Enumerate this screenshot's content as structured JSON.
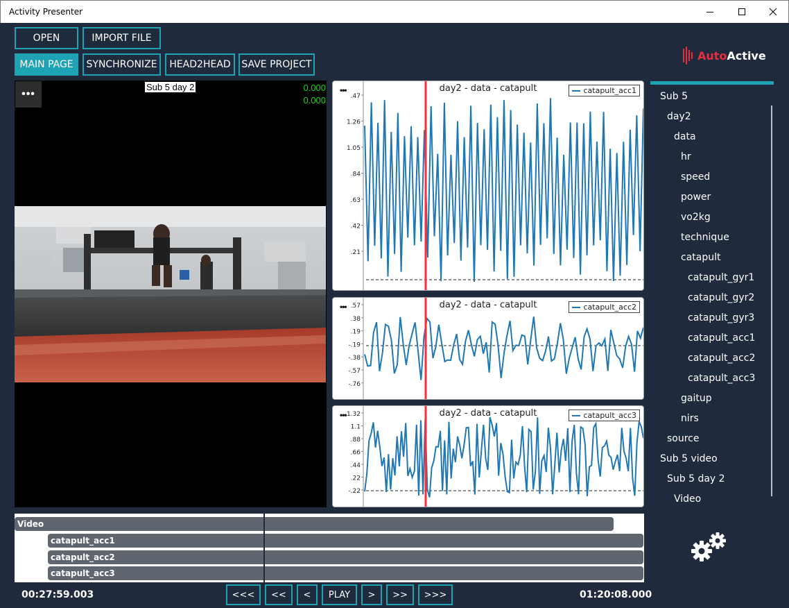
{
  "window": {
    "title": "Activity Presenter"
  },
  "toolbar": {
    "open": "OPEN",
    "import_file": "IMPORT FILE",
    "main_page": "MAIN PAGE",
    "synchronize": "SYNCHRONIZE",
    "head2head": "HEAD2HEAD",
    "save_project": "SAVE PROJECT"
  },
  "logo": {
    "part1": "Auto",
    "part2": "Active"
  },
  "video": {
    "title": "Sub 5 day 2",
    "value1": "0.000",
    "value2": "0.000"
  },
  "charts": [
    {
      "title": "day2 - data - catapult",
      "legend": "catapult_acc1",
      "yticks": [
        ".47",
        "1.26",
        "1.05",
        ".84",
        ".63",
        ".42",
        ".21"
      ]
    },
    {
      "title": "day2 - data - catapult",
      "legend": "catapult_acc2",
      "yticks": [
        ".57",
        ".38",
        ".19",
        "-.19",
        "-.38",
        "-.57",
        "-.76"
      ]
    },
    {
      "title": "day2 - data - catapult",
      "legend": "catapult_acc3",
      "yticks": [
        "1.32",
        "1.1",
        ".88",
        ".66",
        ".44",
        ".22",
        "-.22"
      ]
    }
  ],
  "tree": [
    "Sub 5",
    "day2",
    "data",
    "hr",
    "speed",
    "power",
    "vo2kg",
    "technique",
    "catapult",
    "catapult_gyr1",
    "catapult_gyr2",
    "catapult_gyr3",
    "catapult_acc1",
    "catapult_acc2",
    "catapult_acc3",
    "gaitup",
    "nirs",
    "source",
    "Sub 5 video",
    "Sub 5 day 2",
    "Video"
  ],
  "timeline": {
    "tracks": [
      "Video",
      "catapult_acc1",
      "catapult_acc2",
      "catapult_acc3"
    ]
  },
  "transport": {
    "start_time": "00:27:59.003",
    "end_time": "01:20:08.000",
    "first": "<<<",
    "back_big": "<<",
    "back": "<",
    "play": "PLAY",
    "forward": ">",
    "forward_big": ">>",
    "last": ">>>"
  },
  "colors": {
    "accent": "#1ea3b4",
    "background": "#1f2a3c",
    "series": "#1f77b4",
    "cursor": "#ff2d3c",
    "brand_red": "#e62f3e"
  }
}
